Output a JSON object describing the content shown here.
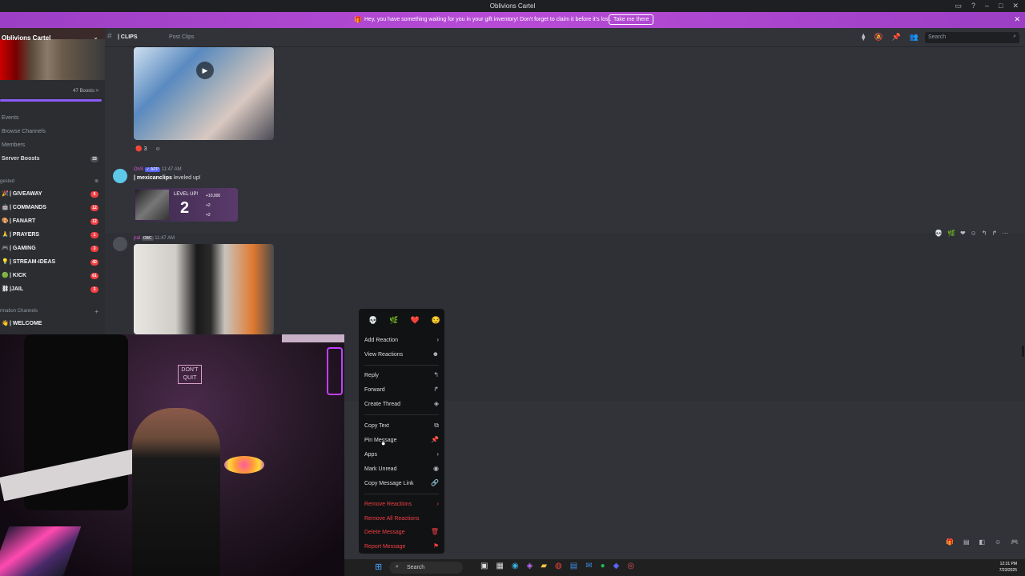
{
  "window": {
    "title": "Oblivions Cartel"
  },
  "banner": {
    "message": "Hey, you have something waiting for you in your gift inventory! Don't forget to claim it before it's lost.",
    "button": "Take me there"
  },
  "sidebar": {
    "server_name": "Oblivions Cartel",
    "boosts": "47 Boosts >",
    "nav": [
      {
        "label": "Events"
      },
      {
        "label": "Browse Channels"
      },
      {
        "label": "Members"
      },
      {
        "label": "Server Boosts",
        "badge": "33"
      }
    ],
    "category1": "gested",
    "channels": [
      {
        "icon": "🎉",
        "label": "| GIVEAWAY",
        "badge": "6"
      },
      {
        "icon": "🤖",
        "label": "| COMMANDS",
        "badge": "12"
      },
      {
        "icon": "🎨",
        "label": "| FANART",
        "badge": "12"
      },
      {
        "icon": "🙏",
        "label": "| PRAYERS",
        "badge": "1"
      },
      {
        "icon": "🎮",
        "label": "| GAMING",
        "badge": "3"
      },
      {
        "icon": "💡",
        "label": "| STREAM-IDEAS",
        "badge": "40"
      },
      {
        "icon": "🟢",
        "label": "| KICK",
        "badge": "61"
      },
      {
        "icon": "⛓",
        "label": "|JAIL",
        "badge": "3"
      }
    ],
    "category2": "rmation Channels",
    "welcome": {
      "icon": "👋",
      "label": "| WELCOME"
    }
  },
  "topbar": {
    "channel_name": "| CLIPS",
    "post_clips": "Post Clips",
    "search_placeholder": "Search"
  },
  "messages": {
    "video_reaction_count": "3",
    "bot": {
      "name": "OnS",
      "tag": "✓ APP",
      "time": "11:47 AM",
      "text_user": "| mexicanclips",
      "text_rest": " leveled up!"
    },
    "level_card": {
      "label": "LEVEL UP!",
      "level": "2",
      "xp": "+10,000",
      "r1": "+2",
      "r2": "+2"
    },
    "user2": {
      "name": "jral",
      "tag": "OBC",
      "time": "11:47 AM"
    }
  },
  "context_menu": {
    "emojis": [
      "💀",
      "🌿",
      "❤️",
      "😏"
    ],
    "items": [
      {
        "label": "Add Reaction",
        "icon": "›"
      },
      {
        "label": "View Reactions",
        "icon": "☻"
      },
      {
        "label": "Reply",
        "icon": "↰"
      },
      {
        "label": "Forward",
        "icon": "↱"
      },
      {
        "label": "Create Thread",
        "icon": "◈"
      },
      {
        "label": "Copy Text",
        "icon": "⧉"
      },
      {
        "label": "Pin Message",
        "icon": "📌"
      },
      {
        "label": "Apps",
        "icon": "›"
      },
      {
        "label": "Mark Unread",
        "icon": "◉"
      },
      {
        "label": "Copy Message Link",
        "icon": "🔗"
      },
      {
        "label": "Remove Reactions",
        "icon": "›"
      },
      {
        "label": "Remove All Reactions",
        "icon": ""
      },
      {
        "label": "Delete Message",
        "icon": "🗑"
      },
      {
        "label": "Report Message",
        "icon": "⚑"
      }
    ]
  },
  "webcam": {
    "neon_text": "DON'T QUIT"
  },
  "taskbar": {
    "search": "Search",
    "time": "12:31 PM",
    "date": "7/23/2025"
  }
}
